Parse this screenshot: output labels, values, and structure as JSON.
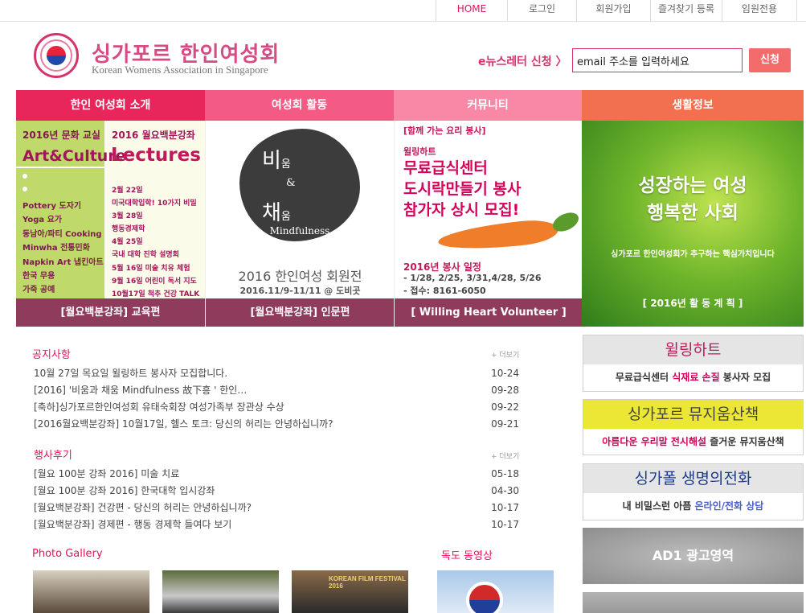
{
  "topnav": [
    "HOME",
    "로그인",
    "회원가입",
    "즐겨찾기 등록",
    "임원전용"
  ],
  "logo": {
    "title": "싱가포르 한인여성회",
    "subtitle": "Korean Womens Association in Singapore"
  },
  "enews": {
    "label": "e뉴스레터 신청 〉",
    "placeholder": "email 주소를 입력하세요",
    "button": "신청"
  },
  "mainmenu": [
    "한인 여성회 소개",
    "여성회 활동",
    "커뮤니티",
    "생활정보"
  ],
  "banner1": {
    "hdr_left": "2016년 문화 교실",
    "big_left": "Art&Culture",
    "hdr_right": "2016 월요백분강좌",
    "big_right": "Lectures",
    "list_left": [
      "Pottery 도자기",
      "Yoga 요가",
      "동남아/파티 Cooking",
      "Minwha 전통민화",
      "Napkin Art 냅킨아트",
      "한국 무용",
      "가죽 공예"
    ],
    "list_right": [
      "2월 22일",
      "미국대학입학! 10가지 비밀",
      "3월 28일",
      "행동경제학",
      "4월 25일",
      "국내 대학 진학 설명회",
      "5월 16일  미술 치유 체험",
      "9월 16일  어린이 독서 지도",
      "10월17일  척추 건강 TALK"
    ],
    "footer": "[월요백분강좌] 교육편"
  },
  "banner2": {
    "blob_line1": "비",
    "blob_small1": "움",
    "blob_amp": "&",
    "blob_line2": "채",
    "blob_small2": "움",
    "mind": "Mindfulness",
    "title": "2016 한인여성 회원전",
    "date": "2016.11/9-11/11 @ 도비곳",
    "footer": "[월요백분강좌] 인문편"
  },
  "banner3": {
    "line1": "[함께 가는 요리 봉사]",
    "line2": "윌링하트",
    "line3a": "무료급식센터",
    "line3b": "도시락만들기 봉사",
    "line3c": "참가자 상시 모집!",
    "sched_title": "2016년 봉사 일정",
    "sched_dates": "- 1/28, 2/25, 3/31,4/28, 5/26",
    "sched_contact": "- 접수: 8161-6050",
    "footer": "[ Willing Heart Volunteer ]"
  },
  "banner4": {
    "line1": "성장하는 여성",
    "line2": "행복한 사회",
    "sub": "싱가포르 한인여성회가 추구하는 핵심가치입니다",
    "plan": "[ 2016년 활 동 계 획 ]"
  },
  "notice": {
    "title": "공지사항",
    "more": "+ 더보기",
    "items": [
      {
        "text": "10월 27일 목요일 윌링하트 봉사자 모집합니다.",
        "date": "10-24"
      },
      {
        "text": "[2016] '비움과 채움 Mindfulness 故下흥 ' 한인…",
        "date": "09-28"
      },
      {
        "text": "[축하]싱가포르한인여성회 유태숙회장 여성가족부 장관상 수상",
        "date": "09-22"
      },
      {
        "text": "[2016월요백분강좌] 10월17일, 헬스 토크: 당신의 허리는 안녕하십니까?",
        "date": "09-21"
      }
    ]
  },
  "events": {
    "title": "행사후기",
    "more": "+ 더보기",
    "items": [
      {
        "text": "[월요 100분 강좌 2016] 미술 치료",
        "date": "05-18"
      },
      {
        "text": "[월요 100분 강좌 2016] 한국대학 입시강좌",
        "date": "04-30"
      },
      {
        "text": "[월요백분강좌] 건강편 - 당신의 허리는 안녕하십니까?",
        "date": "10-17"
      },
      {
        "text": "[월요백분강좌] 경제편 - 행동 경제학 들여다 보기",
        "date": "10-17"
      }
    ]
  },
  "gallery": {
    "title": "Photo Gallery",
    "thumb3_text": "KOREAN FILM FESTIVAL 2016"
  },
  "video": {
    "title": "독도 동영상"
  },
  "side": {
    "willing": {
      "title": "윌링하트",
      "pre": "무료급식센터 ",
      "hl": "식재료 손질",
      "post": " 봉사자 모집"
    },
    "museum": {
      "title": "싱가포르 뮤지움산책",
      "hl": "아름다운 우리말 전시해설",
      "post": " 즐거운 뮤지움산책"
    },
    "lifeline": {
      "title": "싱가폴 생명의전화",
      "pre": "내 비밀스런 아픔 ",
      "hl": "온라인/전화 상담"
    },
    "ad1": "AD1 광고영역"
  },
  "colors": {
    "accent": "#e8125c",
    "menu1": "#e8265c",
    "menu2": "#f35b84",
    "menu3": "#f888a5",
    "menu4": "#f26f4f",
    "banner_footer": "#8f3b5c"
  }
}
